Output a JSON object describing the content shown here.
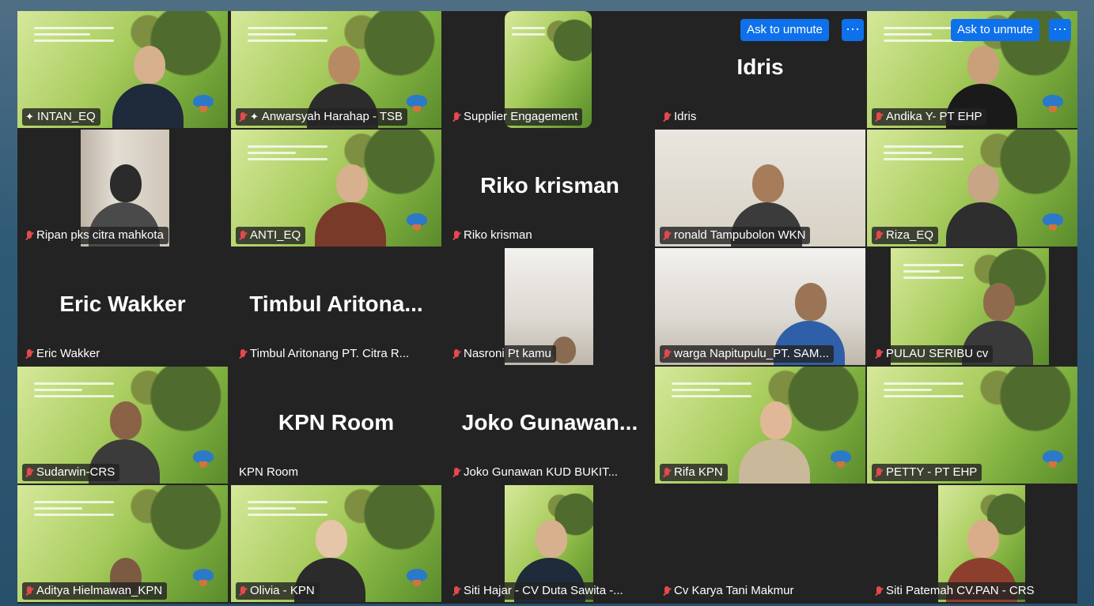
{
  "ask_to_unmute_label": "Ask to unmute",
  "more_label": "···",
  "participants": [
    {
      "label": "INTAN_EQ",
      "pinned": true
    },
    {
      "label": "Anwarsyah Harahap - TSB",
      "pinned": true
    },
    {
      "label": "Supplier Engagement"
    },
    {
      "label": "Idris",
      "display": "Idris"
    },
    {
      "label": "Andika Y- PT EHP"
    },
    {
      "label": "Ripan pks citra mahkota"
    },
    {
      "label": "ANTI_EQ"
    },
    {
      "label": "Riko krisman",
      "display": "Riko krisman"
    },
    {
      "label": "ronald Tampubolon WKN"
    },
    {
      "label": "Riza_EQ"
    },
    {
      "label": "Eric Wakker",
      "display": "Eric Wakker"
    },
    {
      "label": "Timbul Aritonang PT. Citra R...",
      "display": "Timbul  Aritona..."
    },
    {
      "label": "Nasroni Pt kamu"
    },
    {
      "label": "warga Napitupulu_PT. SAM..."
    },
    {
      "label": "PULAU SERIBU cv"
    },
    {
      "label": "Sudarwin-CRS"
    },
    {
      "label": "KPN Room",
      "display": "KPN Room"
    },
    {
      "label": "Joko Gunawan  KUD BUKIT...",
      "display": "Joko  Gunawan..."
    },
    {
      "label": "Rifa KPN"
    },
    {
      "label": "PETTY - PT EHP"
    },
    {
      "label": "Aditya Hielmawan_KPN"
    },
    {
      "label": "Olivia - KPN"
    },
    {
      "label": "Siti Hajar - CV Duta Sawita -..."
    },
    {
      "label": "Cv Karya Tani Makmur"
    },
    {
      "label": "Siti Patemah CV.PAN - CRS"
    }
  ],
  "colors": {
    "accent": "#0e71eb",
    "active_speaker": "#3dd68c",
    "muted": "#e5484d",
    "tile_bg": "#232323"
  }
}
